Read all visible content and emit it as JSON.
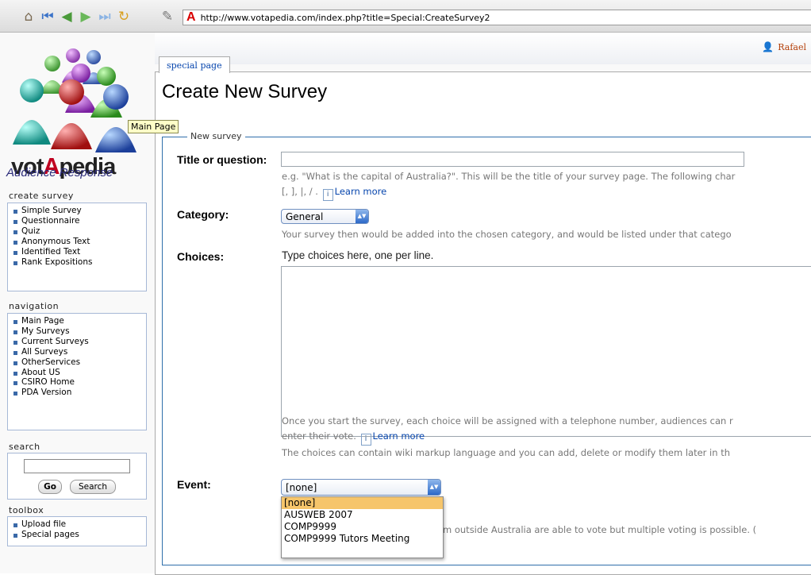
{
  "browser": {
    "url": "http://www.votapedia.com/index.php?title=Special:CreateSurvey2",
    "url_icon": "A",
    "icons": [
      "home-icon",
      "back-start-icon",
      "back-icon",
      "forward-icon",
      "forward-end-icon",
      "reload-icon",
      "edit-icon"
    ]
  },
  "logo": {
    "word_pre": "vot",
    "word_accent": "A",
    "word_post": "pedia",
    "subtitle": "Audience Response",
    "tooltip": "Main Page"
  },
  "sidebar": {
    "create_survey": {
      "title": "create survey",
      "items": [
        {
          "label": "Simple Survey"
        },
        {
          "label": "Questionnaire"
        },
        {
          "label": "Quiz"
        },
        {
          "label": "Anonymous Text"
        },
        {
          "label": "Identified Text"
        },
        {
          "label": "Rank Expositions"
        }
      ]
    },
    "navigation": {
      "title": "navigation",
      "items": [
        {
          "label": "Main Page"
        },
        {
          "label": "My Surveys"
        },
        {
          "label": "Current Surveys"
        },
        {
          "label": "All Surveys"
        },
        {
          "label": "OtherServices"
        },
        {
          "label": "About US"
        },
        {
          "label": "CSIRO Home"
        },
        {
          "label": "PDA Version"
        }
      ]
    },
    "search": {
      "title": "search",
      "go_label": "Go",
      "search_label": "Search",
      "value": ""
    },
    "toolbox": {
      "title": "toolbox",
      "items": [
        {
          "label": "Upload file"
        },
        {
          "label": "Special pages"
        }
      ]
    }
  },
  "header": {
    "tab": "special page",
    "user": "Rafael",
    "title": "Create New Survey"
  },
  "form": {
    "legend": "New survey",
    "title_field": {
      "label": "Title or question:",
      "value": "",
      "hint_line1": "e.g. \"What is the capital of Australia?\". This will be the title of your survey page. The following char",
      "hint_line2": "[, ], |, / .",
      "learn_more": "Learn more"
    },
    "category": {
      "label": "Category:",
      "selected": "General",
      "hint": "Your survey then would be added into the chosen category, and would be listed under that catego"
    },
    "choices": {
      "label": "Choices:",
      "heading": "Type choices here, one per line.",
      "value": "",
      "hint_line1": "Once you start the survey, each choice will be assigned with a telephone number, audiences can r",
      "hint_line2": "enter their vote.",
      "learn_more": "Learn more",
      "hint_line3": "The choices can contain wiki markup language and you can add, delete or modify them later in th"
    },
    "event": {
      "label": "Event:",
      "selected": "[none]",
      "options": [
        "[none]",
        "AUSWEB 2007",
        "COMP9999",
        "COMP9999 Tutors Meeting"
      ],
      "note": "m outside Australia are able to vote but multiple voting is possible. ("
    }
  }
}
